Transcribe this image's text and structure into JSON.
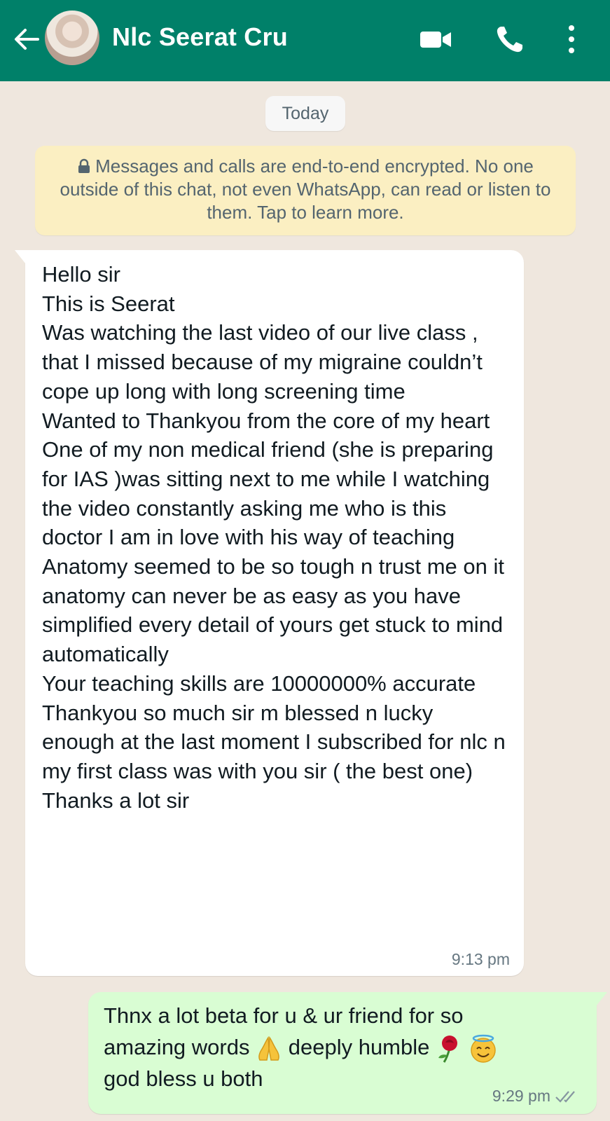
{
  "header": {
    "contact_name": "Nlc Seerat Cru",
    "icons": [
      "back-arrow-icon",
      "video-call-icon",
      "voice-call-icon",
      "more-options-icon"
    ],
    "background_color": "#008069"
  },
  "chat": {
    "date_chip": "Today",
    "encryption_notice": "Messages and calls are end-to-end encrypted. No one outside of this chat, not even WhatsApp, can read or listen to them. Tap to learn more.",
    "incoming": {
      "text": "Hello sir\nThis is Seerat\nWas watching the last video of our live class , that I missed because of my migraine couldn’t cope up long with long screening time\nWanted to Thankyou from the core of my heart\nOne of my non medical friend (she is preparing for IAS )was sitting next to me while I watching the video constantly asking me who is this doctor I am in love with his way of teaching\nAnatomy seemed to be so tough n trust me on it anatomy can never be as easy as you have simplified every detail of yours get stuck to mind automatically\nYour teaching skills are 10000000% accurate\nThankyou so much sir m blessed n lucky enough at the last moment I subscribed for nlc n my first class was with you sir ( the best one)\nThanks a lot sir",
      "time": "9:13 pm"
    },
    "outgoing": {
      "line1": "Thnx a lot beta for u & ur friend for so",
      "line2_a": "amazing words",
      "line2_b": "deeply humble",
      "line3": "god bless u both",
      "emojis": [
        "folded-hands-emoji",
        "rose-emoji",
        "smiling-face-with-halo-emoji"
      ],
      "time": "9:29 pm",
      "status": "read"
    }
  },
  "colors": {
    "chat_background": "#efe7de",
    "incoming_bubble": "#ffffff",
    "outgoing_bubble": "#d9fdd3",
    "encryption_box": "#fbefc2"
  }
}
